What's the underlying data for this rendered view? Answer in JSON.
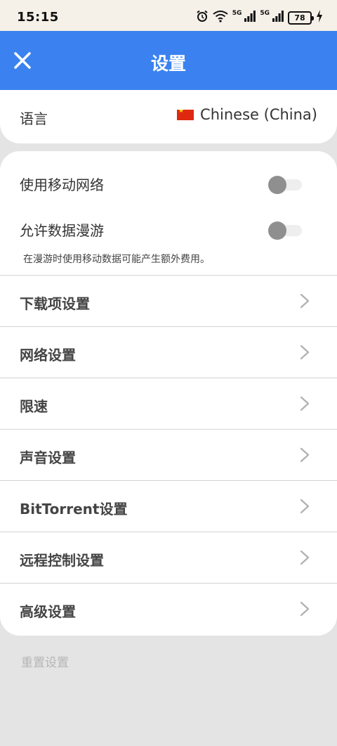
{
  "status_bar": {
    "time": "15:15",
    "network_labels": [
      "5G",
      "5G"
    ],
    "battery": "78",
    "icons": [
      "alarm-icon",
      "wifi-icon",
      "signal-icon",
      "signal-icon",
      "battery-icon",
      "charging-icon"
    ]
  },
  "app_bar": {
    "title": "设置",
    "close_icon": "close-icon",
    "color": "#3b82f0"
  },
  "language": {
    "label": "语言",
    "value": "Chinese (China)",
    "flag": "china-flag-icon"
  },
  "toggles": [
    {
      "label": "使用移动网络",
      "checked": false
    },
    {
      "label": "允许数据漫游",
      "checked": false
    }
  ],
  "roaming_hint": "在漫游时使用移动数据可能产生额外费用。",
  "menu": [
    {
      "label": "下载项设置"
    },
    {
      "label": "网络设置"
    },
    {
      "label": "限速"
    },
    {
      "label": "声音设置"
    },
    {
      "label": "BitTorrent设置"
    },
    {
      "label": "远程控制设置"
    },
    {
      "label": "高级设置"
    }
  ],
  "reset_label": "重置设置"
}
